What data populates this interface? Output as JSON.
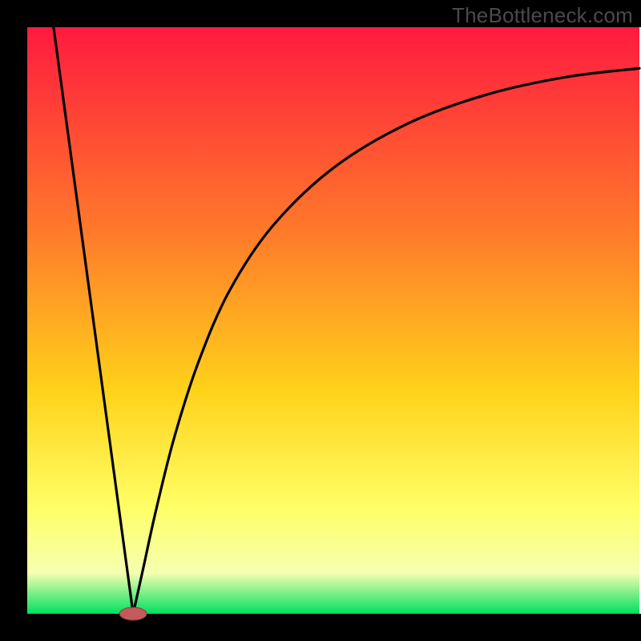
{
  "watermark": "TheBottleneck.com",
  "colors": {
    "frame": "#000000",
    "curve": "#000000",
    "marker_fill": "#c45a5b",
    "marker_stroke": "#8e3d3d",
    "grad_top": "#ff1a3f",
    "grad_mid1": "#ff7a2a",
    "grad_mid2": "#ffd21a",
    "grad_mid3": "#ffff66",
    "grad_mid4": "#f6ffb0",
    "grad_bottom": "#00e060"
  },
  "chart_data": {
    "type": "line",
    "title": "",
    "xlabel": "",
    "ylabel": "",
    "xlim": [
      0,
      100
    ],
    "ylim": [
      0,
      100
    ],
    "min_x": 17.3,
    "min_marker": {
      "x": 17.3,
      "y": 0,
      "rx": 2.2,
      "ry": 1.1
    },
    "left_line": {
      "x0": 4.3,
      "y0": 100,
      "x1": 17.3,
      "y1": 0
    },
    "right_curve": [
      {
        "x": 17.3,
        "y": 0
      },
      {
        "x": 19.0,
        "y": 8.0
      },
      {
        "x": 21.0,
        "y": 17.5
      },
      {
        "x": 24.0,
        "y": 30.0
      },
      {
        "x": 28.0,
        "y": 43.0
      },
      {
        "x": 33.0,
        "y": 55.0
      },
      {
        "x": 40.0,
        "y": 66.0
      },
      {
        "x": 50.0,
        "y": 76.0
      },
      {
        "x": 62.0,
        "y": 83.5
      },
      {
        "x": 75.0,
        "y": 88.5
      },
      {
        "x": 88.0,
        "y": 91.5
      },
      {
        "x": 100.0,
        "y": 93.0
      }
    ],
    "gradient_stops": [
      {
        "offset": 0.0,
        "key": "grad_top"
      },
      {
        "offset": 0.35,
        "key": "grad_mid1"
      },
      {
        "offset": 0.62,
        "key": "grad_mid2"
      },
      {
        "offset": 0.82,
        "key": "grad_mid3"
      },
      {
        "offset": 0.93,
        "key": "grad_mid4"
      },
      {
        "offset": 1.0,
        "key": "grad_bottom"
      }
    ]
  }
}
